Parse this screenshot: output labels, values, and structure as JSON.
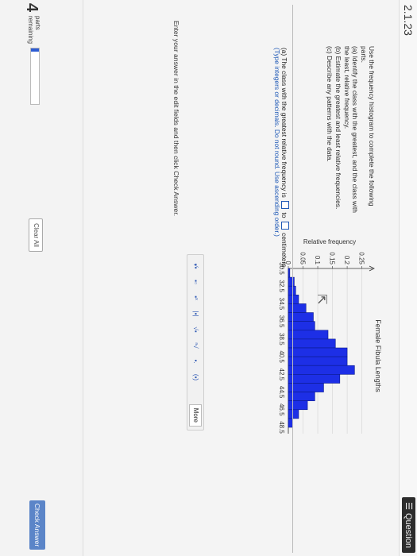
{
  "header": {
    "section": "2.1.23",
    "menu_label": "Question"
  },
  "instructions": {
    "intro": "Use the frequency histogram to complete the following parts.",
    "a": "(a) Identify the class with the greatest, and the class with the least, relative frequency.",
    "b": "(b) Estimate the greatest and least relative frequencies.",
    "c": "(c) Describe any patterns with the data."
  },
  "answer": {
    "prefix": "(a) The class with the greatest relative frequency is",
    "connector": "to",
    "suffix": "centimeters.",
    "hint": "(Type integers or decimals. Do not round. Use ascending order.)"
  },
  "toolbar": {
    "more_label": "More"
  },
  "footer": {
    "note": "Enter your answer in the edit fields and then click Check Answer.",
    "parts_number": "4",
    "parts_label_1": "parts",
    "parts_label_2": "remaining",
    "progress": 0.05,
    "clear_all_label": "Clear All",
    "check_answer_label": "Check Answer"
  },
  "colors": {
    "bar": "#1d2fe6",
    "link": "#1e58b6",
    "check_button": "#5b85c8"
  },
  "chart_data": {
    "type": "bar",
    "title": "Female Fibula Lengths",
    "ylabel": "Relative frequency",
    "xlabel": "",
    "x_ticks": [
      "30.5",
      "32.5",
      "34.5",
      "36.5",
      "38.5",
      "40.5",
      "42.5",
      "44.5",
      "46.5",
      "48.5"
    ],
    "y_ticks": [
      "0",
      "0.05",
      "0.1",
      "0.15",
      "0.2",
      "0.25"
    ],
    "ylim": [
      0,
      0.27
    ],
    "bin_edges": [
      30.5,
      31.5,
      32.5,
      33.5,
      34.5,
      35.5,
      36.5,
      37.5,
      38.5,
      39.5,
      40.5,
      41.5,
      42.5,
      43.5,
      44.5,
      45.5,
      46.5,
      47.5,
      48.5
    ],
    "values": [
      0.005,
      0.02,
      0.025,
      0.035,
      0.06,
      0.085,
      0.09,
      0.135,
      0.16,
      0.2,
      0.2,
      0.225,
      0.175,
      0.12,
      0.09,
      0.065,
      0.035,
      0.015
    ]
  }
}
